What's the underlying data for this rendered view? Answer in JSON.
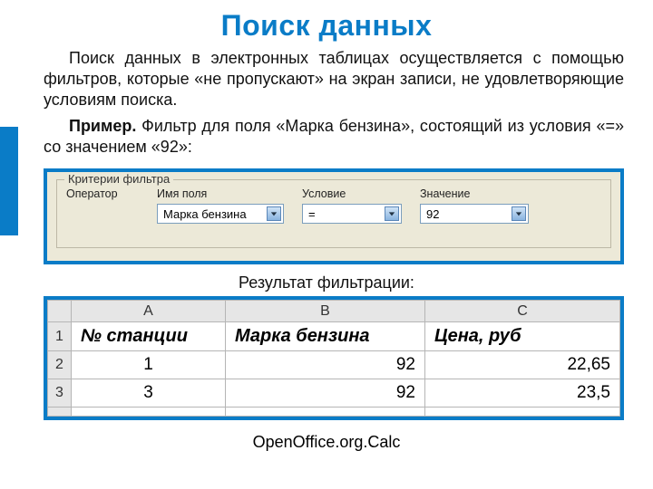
{
  "title": "Поиск данных",
  "para1": "Поиск данных в электронных таблицах осуществляется с помощью фильтров, которые «не пропускают» на экран записи, не удовлетворяющие условиям поиска.",
  "para2_label": "Пример.",
  "para2_rest": " Фильтр для поля «Марка бензина», состоящий из условия «=» со значением «92»:",
  "filter": {
    "group_title": "Критерии фильтра",
    "cols": {
      "operator": "Оператор",
      "field": "Имя поля",
      "cond": "Условие",
      "value": "Значение"
    },
    "values": {
      "field": "Марка бензина",
      "cond": "=",
      "value": "92"
    }
  },
  "result_label": "Результат фильтрации:",
  "sheet": {
    "col_letters": [
      "A",
      "B",
      "C"
    ],
    "header_row_num": "1",
    "headers": [
      "№ станции",
      "Марка бензина",
      "Цена, руб"
    ],
    "rows": [
      {
        "num": "2",
        "cells": [
          "1",
          "92",
          "22,65"
        ]
      },
      {
        "num": "3",
        "cells": [
          "3",
          "92",
          "23,5"
        ]
      }
    ]
  },
  "footer": "OpenOffice.org.Calc"
}
